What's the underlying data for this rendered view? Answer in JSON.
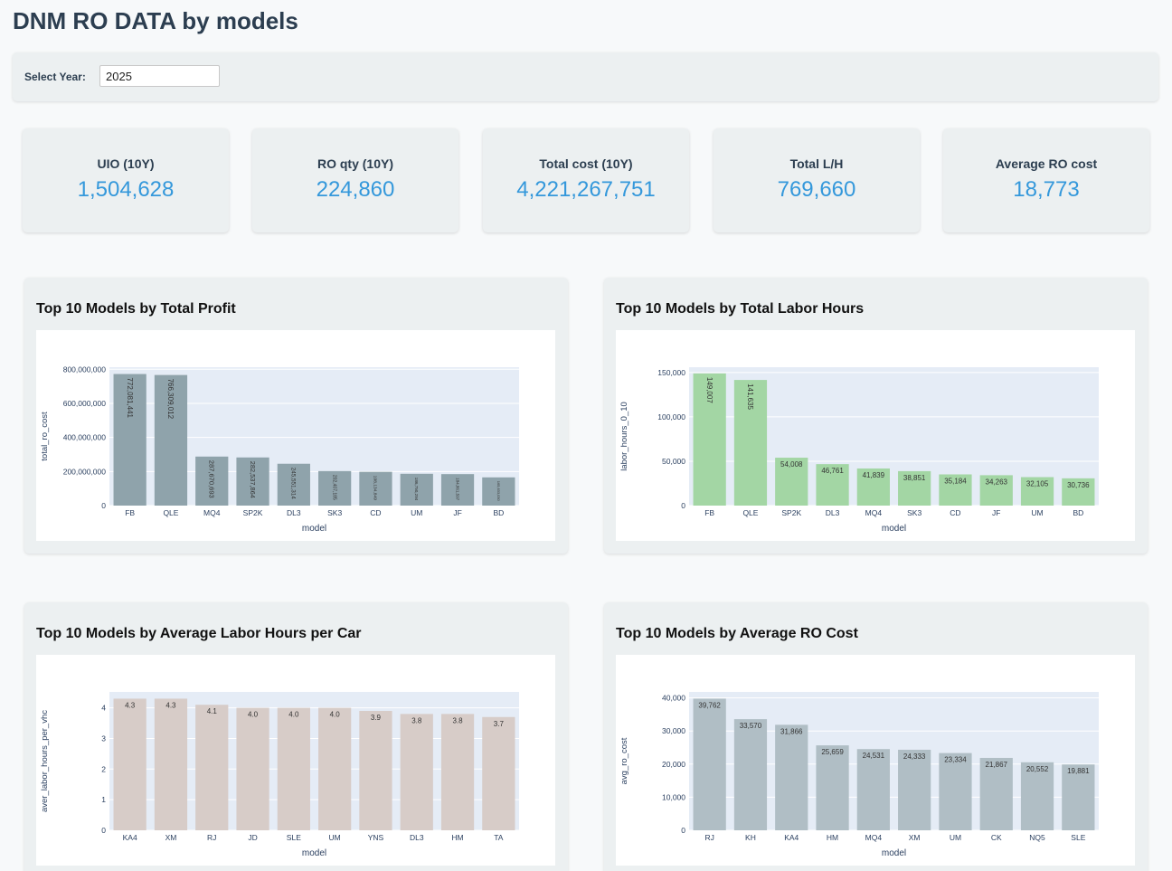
{
  "header": {
    "title": "DNM RO DATA by models"
  },
  "filter": {
    "label": "Select Year:",
    "value": "2025"
  },
  "kpis": [
    {
      "label": "UIO (10Y)",
      "value": "1,504,628"
    },
    {
      "label": "RO qty (10Y)",
      "value": "224,860"
    },
    {
      "label": "Total cost (10Y)",
      "value": "4,221,267,751"
    },
    {
      "label": "Total L/H",
      "value": "769,660"
    },
    {
      "label": "Average RO cost",
      "value": "18,773"
    }
  ],
  "colors": {
    "accent": "#3498db",
    "panel": "#ecf0f1",
    "plot_bg": "#e5ecf6"
  },
  "chart_data": [
    {
      "title": "Top 10 Models by Total Profit",
      "type": "bar",
      "categories": [
        "FB",
        "QLE",
        "MQ4",
        "SP2K",
        "DL3",
        "SK3",
        "CD",
        "UM",
        "JF",
        "BD"
      ],
      "values": [
        772081441,
        766309012,
        287670693,
        282537864,
        245551314,
        202407185,
        198134849,
        186750294,
        184861597,
        165633030
      ],
      "value_labels": [
        "772,081,441",
        "766,309,012",
        "287,670,693",
        "282,537,864",
        "245,551,314",
        "202,407,185",
        "198,134,849",
        "186,750,294",
        "184,861,597",
        "165,633,030"
      ],
      "xlabel": "model",
      "ylabel": "total_ro_cost",
      "ylim": [
        0,
        812000000
      ],
      "yticks": [
        0,
        200000000,
        400000000,
        600000000,
        800000000
      ],
      "ytick_labels": [
        "0",
        "200,000,000",
        "400,000,000",
        "600,000,000",
        "800,000,000"
      ],
      "bar_color": "#8fa3ab",
      "label_rotation": "vertical"
    },
    {
      "title": "Top 10 Models by Total Labor Hours",
      "type": "bar",
      "categories": [
        "FB",
        "QLE",
        "SP2K",
        "DL3",
        "MQ4",
        "SK3",
        "CD",
        "JF",
        "UM",
        "BD"
      ],
      "values": [
        149007,
        141635,
        54008,
        46761,
        41839,
        38851,
        35184,
        34263,
        32105,
        30736
      ],
      "value_labels": [
        "149,007",
        "141,635",
        "54,008",
        "46,761",
        "41,839",
        "38,851",
        "35,184",
        "34,263",
        "32,105",
        "30,736"
      ],
      "xlabel": "model",
      "ylabel": "labor_hours_0_10",
      "ylim": [
        0,
        156000
      ],
      "yticks": [
        0,
        50000,
        100000,
        150000
      ],
      "ytick_labels": [
        "0",
        "50,000",
        "100,000",
        "150,000"
      ],
      "bar_color": "#a3d6a4",
      "label_rotation": "vertical-top2"
    },
    {
      "title": "Top 10 Models by Average Labor Hours per Car",
      "type": "bar",
      "categories": [
        "KA4",
        "XM",
        "RJ",
        "JD",
        "SLE",
        "UM",
        "YNS",
        "DL3",
        "HM",
        "TA"
      ],
      "values": [
        4.3,
        4.3,
        4.1,
        4.0,
        4.0,
        4.0,
        3.9,
        3.8,
        3.8,
        3.7
      ],
      "value_labels": [
        "4.3",
        "4.3",
        "4.1",
        "4.0",
        "4.0",
        "4.0",
        "3.9",
        "3.8",
        "3.8",
        "3.7"
      ],
      "xlabel": "model",
      "ylabel": "aver_labor_hours_per_vhc",
      "ylim": [
        0,
        4.52
      ],
      "yticks": [
        0,
        1,
        2,
        3,
        4
      ],
      "ytick_labels": [
        "0",
        "1",
        "2",
        "3",
        "4"
      ],
      "bar_color": "#d7ccc8",
      "label_rotation": "horizontal"
    },
    {
      "title": "Top 10 Models by Average RO Cost",
      "type": "bar",
      "categories": [
        "RJ",
        "KH",
        "KA4",
        "HM",
        "MQ4",
        "XM",
        "UM",
        "CK",
        "NQ5",
        "SLE"
      ],
      "values": [
        39762,
        33570,
        31866,
        25659,
        24531,
        24333,
        23334,
        21867,
        20552,
        19881
      ],
      "value_labels": [
        "39,762",
        "33,570",
        "31,866",
        "25,659",
        "24,531",
        "24,333",
        "23,334",
        "21,867",
        "20,552",
        "19,881"
      ],
      "xlabel": "model",
      "ylabel": "avg_ro_cost",
      "ylim": [
        0,
        41800
      ],
      "yticks": [
        0,
        10000,
        20000,
        30000,
        40000
      ],
      "ytick_labels": [
        "0",
        "10,000",
        "20,000",
        "30,000",
        "40,000"
      ],
      "bar_color": "#b0bec5",
      "label_rotation": "horizontal"
    }
  ]
}
